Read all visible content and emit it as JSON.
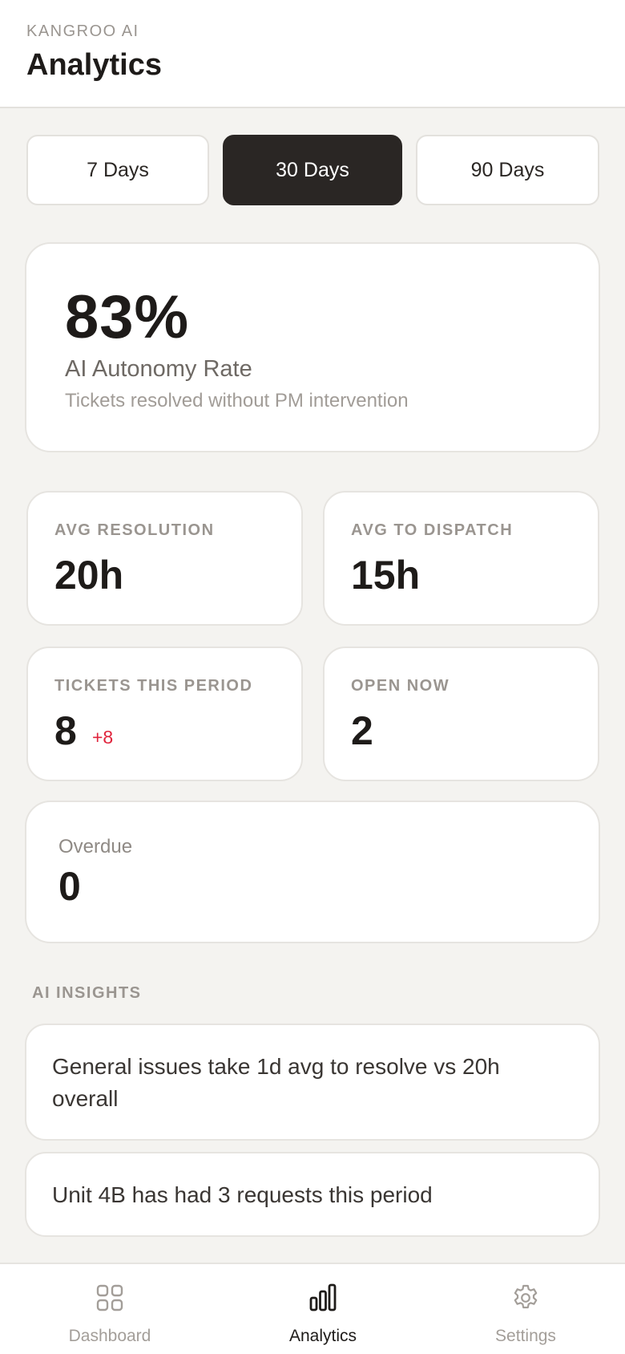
{
  "header": {
    "brand": "KANGROO AI",
    "title": "Analytics"
  },
  "range_tabs": [
    {
      "label": "7 Days",
      "active": false
    },
    {
      "label": "30 Days",
      "active": true
    },
    {
      "label": "90 Days",
      "active": false
    }
  ],
  "autonomy": {
    "value": "83%",
    "label": "AI Autonomy Rate",
    "subtitle": "Tickets resolved without PM intervention"
  },
  "stats": {
    "avg_resolution": {
      "label": "AVG RESOLUTION",
      "value": "20h"
    },
    "avg_dispatch": {
      "label": "AVG TO DISPATCH",
      "value": "15h"
    },
    "tickets_period": {
      "label": "TICKETS THIS PERIOD",
      "value": "8",
      "delta": "+8"
    },
    "open_now": {
      "label": "OPEN NOW",
      "value": "2"
    }
  },
  "overdue": {
    "label": "Overdue",
    "value": "0"
  },
  "insights": {
    "title": "AI INSIGHTS",
    "items": [
      "General issues take 1d avg to resolve vs 20h overall",
      "Unit 4B has had 3 requests this period"
    ]
  },
  "nav": {
    "items": [
      {
        "label": "Dashboard",
        "icon": "grid-icon",
        "active": false
      },
      {
        "label": "Analytics",
        "icon": "bar-chart-icon",
        "active": true
      },
      {
        "label": "Settings",
        "icon": "gear-icon",
        "active": false
      }
    ]
  },
  "colors": {
    "background": "#f4f3f0",
    "active_tab": "#2a2624",
    "delta_positive": "#e0243c"
  }
}
